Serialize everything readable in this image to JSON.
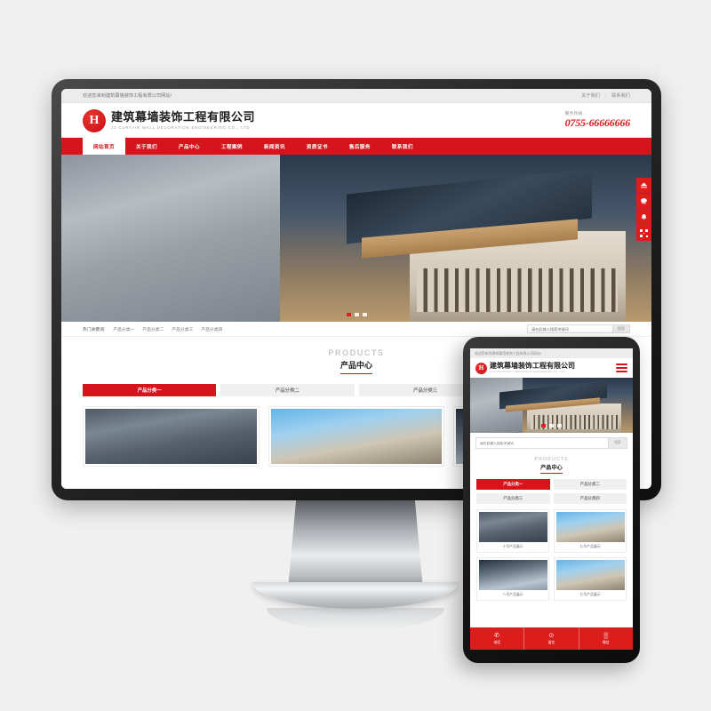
{
  "site": {
    "topbar_welcome": "欢迎您来到建筑幕墙装饰工程有限公司网站!",
    "top_links": [
      "关于我们",
      "联系我们"
    ],
    "separator": "|",
    "logo_letter": "H",
    "company_cn": "建筑幕墙装饰工程有限公司",
    "company_en": "JZ CURTAIN WALL DECORATION ENGINEERING CO., LTD.",
    "tel_label": "服务热线:",
    "tel_number": "0755-66666666"
  },
  "nav": {
    "items": [
      {
        "label": "网站首页",
        "active": true
      },
      {
        "label": "关于我们",
        "active": false
      },
      {
        "label": "产品中心",
        "active": false
      },
      {
        "label": "工程案例",
        "active": false
      },
      {
        "label": "新闻资讯",
        "active": false
      },
      {
        "label": "资质证书",
        "active": false
      },
      {
        "label": "售后服务",
        "active": false
      },
      {
        "label": "联系我们",
        "active": false
      }
    ]
  },
  "banner": {
    "dots": [
      "active",
      "idle",
      "idle"
    ]
  },
  "keywords": {
    "label": "热门关键词:",
    "items": [
      "产品分类一",
      "产品分类二",
      "产品分类三",
      "产品分类四"
    ]
  },
  "search": {
    "placeholder": "请在此输入搜索关键词",
    "button_label": "搜索"
  },
  "products": {
    "title_en": "PRODUCTS",
    "title_cn": "产品中心",
    "tabs": [
      {
        "label": "产品分类一",
        "active": true
      },
      {
        "label": "产品分类二",
        "active": false
      },
      {
        "label": "产品分类三",
        "active": false
      },
      {
        "label": "产品分类四",
        "active": false
      }
    ],
    "cards": [
      {
        "caption": "十号产品展示"
      },
      {
        "caption": "九号产品展示"
      },
      {
        "caption": "八号产品展示"
      }
    ]
  },
  "mobile": {
    "topbar_welcome": "欢迎您来到建筑幕墙装饰工程有限公司网站!",
    "menu_icon": "hamburger-icon",
    "cards": [
      {
        "caption": "十号产品展示"
      },
      {
        "caption": "九号产品展示"
      },
      {
        "caption": "八号产品展示"
      },
      {
        "caption": "七号产品展示"
      }
    ],
    "bottom_nav": [
      {
        "icon": "phone-icon",
        "glyph": "✆",
        "label": "电话"
      },
      {
        "icon": "message-icon",
        "glyph": "⊙",
        "label": "留言"
      },
      {
        "icon": "qrcode-icon",
        "glyph": "▒",
        "label": "微信"
      }
    ]
  },
  "float_buttons": [
    {
      "icon": "back-to-top-icon",
      "glyph": "▲"
    },
    {
      "icon": "phone-icon",
      "glyph": "☎"
    },
    {
      "icon": "bell-icon",
      "glyph": "⚑"
    },
    {
      "icon": "qrcode-icon",
      "glyph": ""
    }
  ],
  "colors": {
    "brand_red": "#d5141c",
    "float_red": "#dd1c1c",
    "topbar_gray": "#ececec"
  }
}
